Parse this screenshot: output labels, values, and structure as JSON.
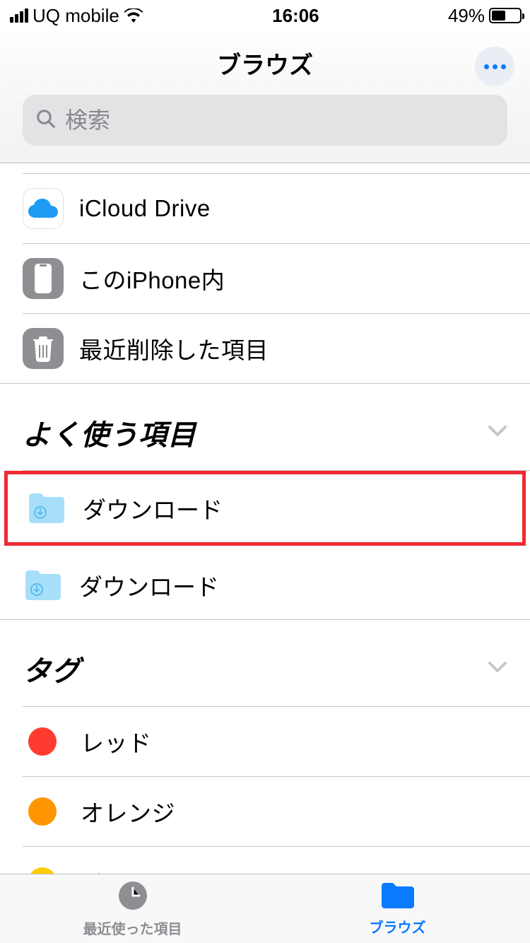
{
  "status_bar": {
    "carrier": "UQ mobile",
    "time": "16:06",
    "battery_percent": "49%",
    "battery_fill_width": "49%"
  },
  "nav": {
    "title": "ブラウズ"
  },
  "search": {
    "placeholder": "検索"
  },
  "locations": [
    {
      "label": "iCloud Drive"
    },
    {
      "label": "このiPhone内"
    },
    {
      "label": "最近削除した項目"
    }
  ],
  "sections": {
    "favorites": {
      "title": "よく使う項目",
      "items": [
        {
          "label": "ダウンロード"
        },
        {
          "label": "ダウンロード"
        }
      ]
    },
    "tags": {
      "title": "タグ",
      "items": [
        {
          "label": "レッド",
          "color": "#ff3b30"
        },
        {
          "label": "オレンジ",
          "color": "#ff9500"
        },
        {
          "label": "イエロー",
          "color": "#ffcc00"
        }
      ]
    }
  },
  "tabs": {
    "recents": {
      "label": "最近使った項目"
    },
    "browse": {
      "label": "ブラウズ"
    }
  },
  "colors": {
    "accent": "#0a7aff",
    "highlight_border": "#ef2a33",
    "folder": "#a7dffb"
  }
}
